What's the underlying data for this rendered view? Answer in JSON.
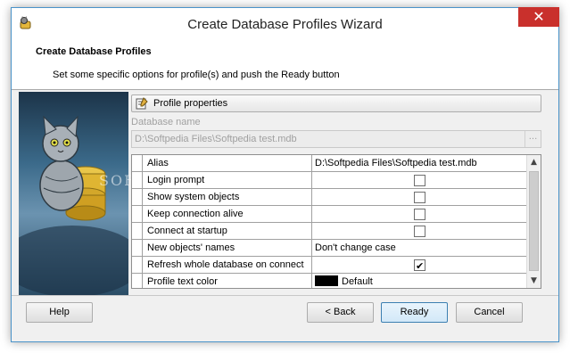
{
  "window": {
    "title": "Create Database Profiles Wizard",
    "close_glyph": "✕"
  },
  "header": {
    "title": "Create Database Profiles",
    "subtitle": "Set some specific options for profile(s) and push the Ready button"
  },
  "side_panel": {
    "watermark": "SOFTPEDIA"
  },
  "profile_properties": {
    "label": "Profile properties",
    "icon": "properties-icon"
  },
  "database_name": {
    "label": "Database name",
    "value": "D:\\Softpedia Files\\Softpedia test.mdb",
    "browse": "..."
  },
  "properties": [
    {
      "name": "Alias",
      "type": "text",
      "value": "D:\\Softpedia Files\\Softpedia test.mdb"
    },
    {
      "name": "Login prompt",
      "type": "checkbox",
      "checked": false
    },
    {
      "name": "Show system objects",
      "type": "checkbox",
      "checked": false
    },
    {
      "name": "Keep connection alive",
      "type": "checkbox",
      "checked": false
    },
    {
      "name": "Connect at startup",
      "type": "checkbox",
      "checked": false
    },
    {
      "name": "New objects' names",
      "type": "text",
      "value": "Don't change case"
    },
    {
      "name": "Refresh whole database on connect",
      "type": "checkbox",
      "checked": true
    },
    {
      "name": "Profile text color",
      "type": "color",
      "value": "Default",
      "color": "#000000"
    }
  ],
  "buttons": {
    "help": "Help",
    "back": "< Back",
    "ready": "Ready",
    "cancel": "Cancel"
  },
  "colors": {
    "accent": "#4a93c9",
    "close": "#c9302c"
  }
}
